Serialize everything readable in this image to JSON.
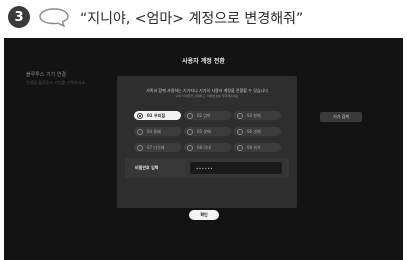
{
  "caption": {
    "step": "3",
    "text": "“지니야, <엄마> 계정으로 변경해줘”"
  },
  "background": {
    "title": "블루투스 기기 연결",
    "subtitle": "연결할 블루투스 기기를 선택하세요.",
    "button_label": "기기 검색"
  },
  "dialog": {
    "title": "사용자 계정 전환",
    "description": "가족과 함께 사용하는 기가지니 기기의 사용자 계정을 전환할 수 있습니다",
    "hint": "나의 닉네임을 선택하고, 비밀번호를 입력해주세요",
    "options": [
      {
        "label": "01 우리집",
        "selected": true
      },
      {
        "label": "02 엄마",
        "selected": false
      },
      {
        "label": "03 첫째",
        "selected": false
      },
      {
        "label": "04 둘째",
        "selected": false
      },
      {
        "label": "05 셋째",
        "selected": false
      },
      {
        "label": "06 넷째",
        "selected": false
      },
      {
        "label": "07 다섯째",
        "selected": false
      },
      {
        "label": "08 막내",
        "selected": false
      },
      {
        "label": "09 외가",
        "selected": false
      }
    ],
    "password_label": "비밀번호 입력",
    "password_value": "••••••",
    "confirm_label": "확인"
  }
}
